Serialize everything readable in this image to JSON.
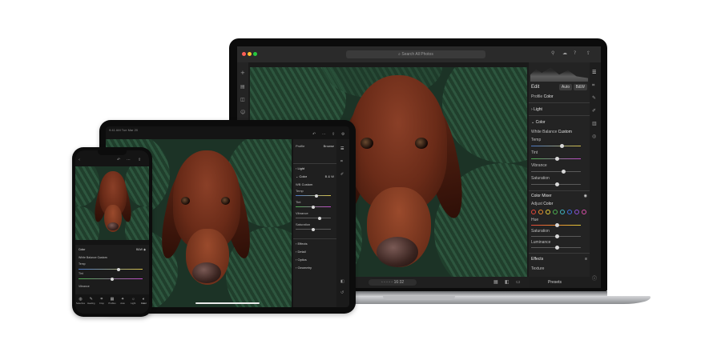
{
  "laptop": {
    "search_placeholder": "Search All Photos",
    "panel": {
      "edit_title": "Edit",
      "auto_button": "Auto",
      "bw_button": "B&W",
      "treatment_label": "Profile",
      "treatment_value": "Color",
      "light_section": "Light",
      "color_section": "Color",
      "white_balance_label": "White Balance",
      "white_balance_value": "Custom",
      "sliders": [
        "Temp",
        "Tint",
        "Vibrance",
        "Saturation"
      ],
      "color_mixer_label": "Color Mixer",
      "adjust_label": "Adjust",
      "adjust_value": "Color",
      "mixer_sliders": [
        "Hue",
        "Saturation",
        "Luminance"
      ],
      "effects_section": "Effects",
      "texture_label": "Texture",
      "presets_button": "Presets",
      "swatch_colors": [
        "#e0463a",
        "#e88a2e",
        "#e3c93a",
        "#4caf50",
        "#3fb6c4",
        "#3f6fe0",
        "#8e52d8",
        "#d94fa8"
      ]
    },
    "filmstrip_label": "16:32"
  },
  "tablet": {
    "status_left": "9:41 AM  Tue Mar 20",
    "panel": {
      "profile_label": "Profile",
      "profile_value": "Browse",
      "light_section": "Light",
      "color_section": "Color",
      "color_value": "B & W",
      "wb_label": "WB",
      "wb_value": "Custom",
      "sliders": [
        "Temp",
        "Tint",
        "Vibrance",
        "Saturation"
      ],
      "effects_section": "Effects",
      "detail_section": "Detail",
      "optics_section": "Optics",
      "geometry_section": "Geometry"
    }
  },
  "phone": {
    "panel": {
      "color_label": "Color",
      "bw_label": "B&W",
      "white_balance_label": "White Balance",
      "white_balance_value": "Custom",
      "sliders": [
        "Temp",
        "Tint"
      ],
      "vibrance_label": "Vibrance",
      "toolbar": [
        "Selective",
        "Healing",
        "Crop",
        "Profiles",
        "Auto",
        "Light",
        "Color"
      ]
    }
  }
}
